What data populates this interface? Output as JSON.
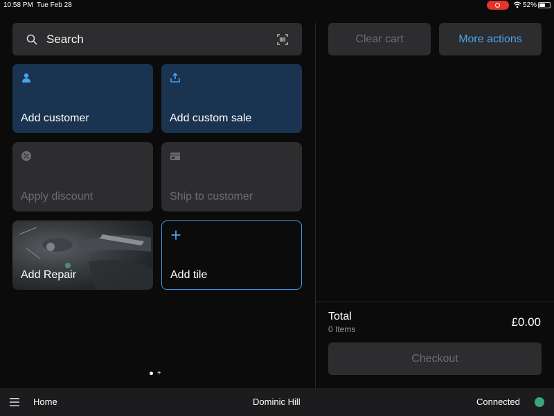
{
  "status_bar": {
    "time": "10:58 PM",
    "date": "Tue Feb 28",
    "battery": "52%",
    "wifi_icon": "wifi-icon",
    "recording_color": "#e5342c"
  },
  "search": {
    "label": "Search",
    "search_icon": "search-icon",
    "barcode_icon": "barcode-scan-icon"
  },
  "tiles": [
    {
      "label": "Add customer",
      "icon": "person-icon",
      "style": "blue"
    },
    {
      "label": "Add custom sale",
      "icon": "upload-tray-icon",
      "style": "blue"
    },
    {
      "label": "Apply discount",
      "icon": "discount-badge-icon",
      "style": "disabled"
    },
    {
      "label": "Ship to customer",
      "icon": "shipping-box-icon",
      "style": "disabled"
    },
    {
      "label": "Add Repair",
      "icon": "photo-image",
      "style": "photo"
    },
    {
      "label": "Add tile",
      "icon": "plus-icon",
      "style": "outline"
    }
  ],
  "pager": {
    "current_page": 1,
    "add_symbol": "+"
  },
  "cart": {
    "clear_label": "Clear cart",
    "more_label": "More actions",
    "total_label": "Total",
    "items_label": "0 Items",
    "total_amount": "£0.00",
    "checkout_label": "Checkout"
  },
  "bottom_bar": {
    "menu_icon": "hamburger-menu-icon",
    "home_label": "Home",
    "user_name": "Dominic Hill",
    "connection_label": "Connected",
    "connection_color": "#3aa57a"
  },
  "colors": {
    "accent": "#4aa3ee",
    "tile_blue": "#1a3350",
    "tile_gray": "#2d2d2f",
    "background": "#0b0b0b"
  }
}
